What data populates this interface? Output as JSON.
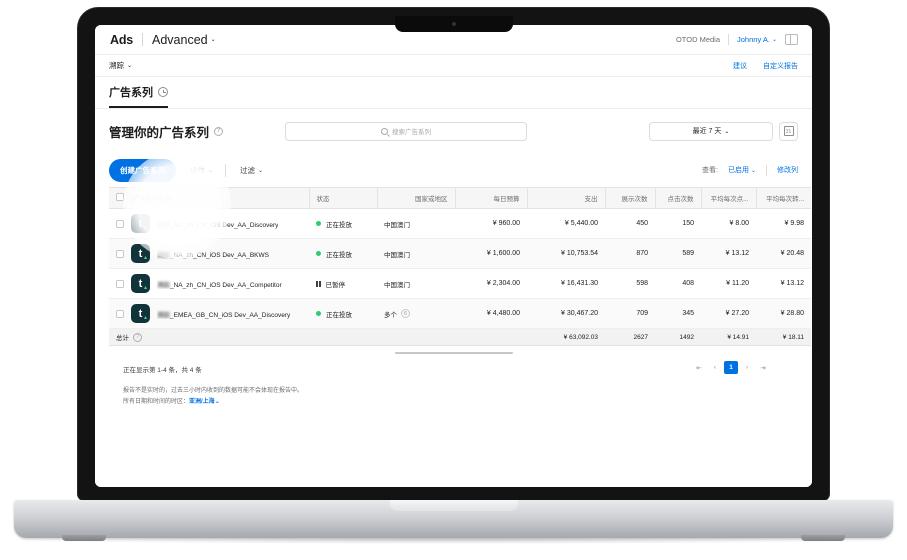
{
  "topbar": {
    "apple_glyph": "",
    "brand": "Ads",
    "edition": "Advanced",
    "edition_caret": "⌄",
    "org": "OTOD Media",
    "user": "Johnny A.",
    "user_caret": "⌄",
    "panel_icon": "panel-toggle-icon"
  },
  "subbar": {
    "left_label": "溯踪",
    "left_caret": "⌄",
    "links": [
      "建议",
      "自定义报告"
    ]
  },
  "tabs": [
    {
      "label": "广告系列",
      "icon": "clock-icon",
      "active": true
    }
  ],
  "page": {
    "title": "管理你的广告系列",
    "help_icon": "?"
  },
  "search": {
    "placeholder": "搜索广告系列",
    "value": "",
    "icon": "search-icon"
  },
  "date_filter": {
    "value": "最近 7 天",
    "caret": "⌄",
    "calendar_icon": "31"
  },
  "actions": {
    "create_label": "创建广告系列",
    "ops_label": "操作",
    "ops_caret": "⌄",
    "filter_label": "过滤",
    "filter_caret": "⌄",
    "view_label": "查看:",
    "view_value": "已启用",
    "view_caret": "⌄",
    "edit_columns": "修改列"
  },
  "table": {
    "columns": [
      "广告系列名称",
      "状态",
      "国家或地区",
      "每日预算",
      "支出",
      "展示次数",
      "点击次数",
      "平均每次点...",
      "平均每次转..."
    ],
    "rows": [
      {
        "app_icon_letter": "t",
        "name_prefix": "溯踪",
        "name": "_NA_zh_CN_iOS Dev_AA_Discovery",
        "status": "正在投放",
        "status_type": "running",
        "geo": "中国澳门",
        "geo_badge": "",
        "daily_budget": "¥ 960.00",
        "spend": "¥ 5,440.00",
        "impressions": "450",
        "clicks": "150",
        "avg_cpt": "¥ 8.00",
        "avg_cpa": "¥ 9.98"
      },
      {
        "app_icon_letter": "t",
        "name_prefix": "溯踪",
        "name": "_NA_zh_CN_iOS Dev_AA_BKWS",
        "status": "正在投放",
        "status_type": "running",
        "geo": "中国澳门",
        "geo_badge": "",
        "daily_budget": "¥ 1,600.00",
        "spend": "¥ 10,753.54",
        "impressions": "870",
        "clicks": "589",
        "avg_cpt": "¥ 13.12",
        "avg_cpa": "¥ 20.48"
      },
      {
        "app_icon_letter": "t",
        "name_prefix": "溯踪",
        "name": "_NA_zh_CN_iOS Dev_AA_Competitor",
        "status": "已暂停",
        "status_type": "paused",
        "geo": "中国澳门",
        "geo_badge": "",
        "daily_budget": "¥ 2,304.00",
        "spend": "¥ 16,431.30",
        "impressions": "598",
        "clicks": "408",
        "avg_cpt": "¥ 11.20",
        "avg_cpa": "¥ 13.12"
      },
      {
        "app_icon_letter": "t",
        "name_prefix": "溯踪",
        "name": "_EMEA_GB_CN_iOS Dev_AA_Discovery",
        "status": "正在投放",
        "status_type": "running",
        "geo": "多个",
        "geo_badge": "6",
        "daily_budget": "¥ 4,480.00",
        "spend": "¥ 30,467.20",
        "impressions": "709",
        "clicks": "345",
        "avg_cpt": "¥ 27.20",
        "avg_cpa": "¥ 28.80"
      }
    ],
    "totals": {
      "label": "总计",
      "help_icon": "?",
      "daily_budget": "",
      "spend": "¥ 63,092.03",
      "impressions": "2627",
      "clicks": "1492",
      "avg_cpt": "¥ 14.91",
      "avg_cpa": "¥ 18.11"
    }
  },
  "footer": {
    "count_text": "正在显示第 1-4 条，共 4 条",
    "note_line1": "报告不是实时的，过去三小时内收到的数据可能不会体现在报告中。",
    "note_line2_prefix": "所有日期和时间的时区：",
    "timezone": "亚洲/上海",
    "timezone_caret": "⌄"
  },
  "pagination": {
    "first": "⇤",
    "prev": "‹",
    "current": "1",
    "next": "›",
    "last": "⇥"
  },
  "colors": {
    "accent": "#0071e3",
    "running": "#2ecc71",
    "app_icon_bg": "#11333a",
    "header_bg": "#f6f6f6",
    "totals_bg": "#f2f2f2"
  }
}
